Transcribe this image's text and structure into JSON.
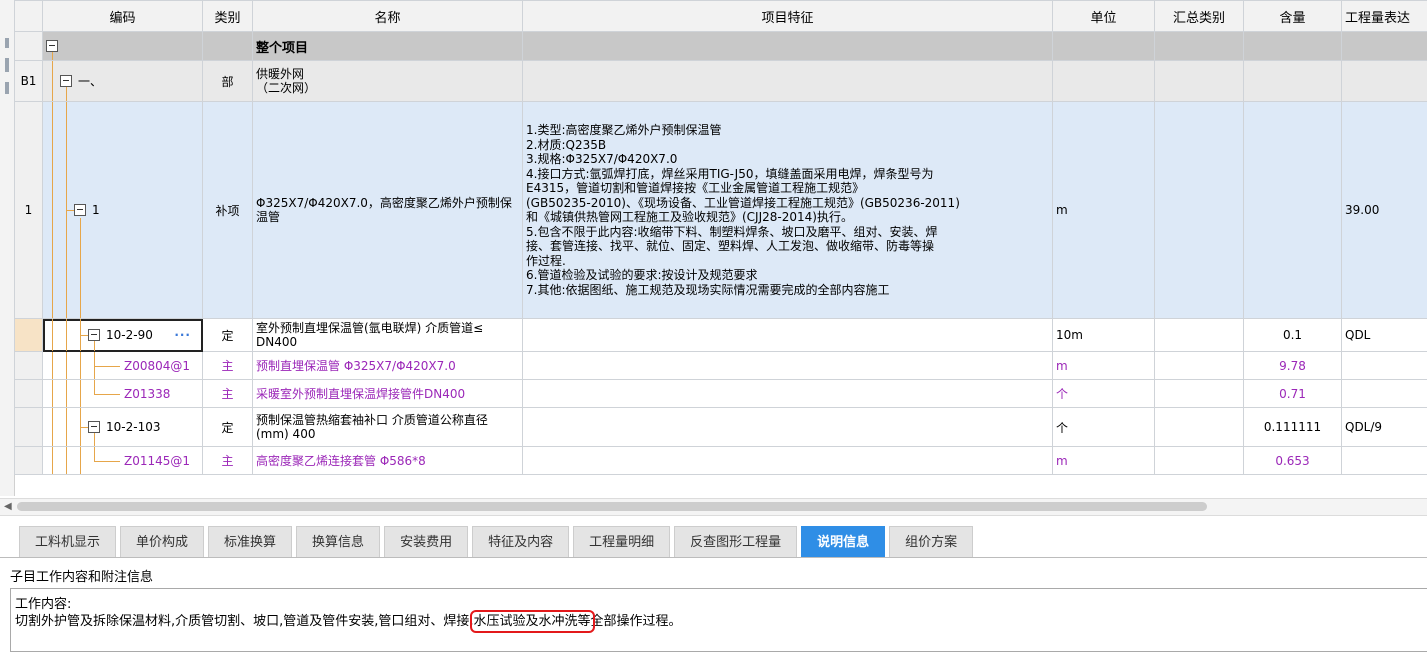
{
  "headers": {
    "code": "编码",
    "type": "类别",
    "name": "名称",
    "features": "项目特征",
    "unit": "单位",
    "summary": "汇总类别",
    "qty": "含量",
    "expr": "工程量表达"
  },
  "rows": {
    "whole": {
      "name": "整个项目"
    },
    "section": {
      "rownum": "B1",
      "code": "一、",
      "type": "部",
      "name": "供暖外网\n（二次网）"
    },
    "bill": {
      "rownum": "1",
      "code": "1",
      "type": "补项",
      "name": "Φ325X7/Φ420X7.0，高密度聚乙烯外户预制保温管",
      "unit": "m",
      "expr": "39.00",
      "features": [
        "1.类型:高密度聚乙烯外户预制保温管",
        "2.材质:Q235B",
        "3.规格:Φ325X7/Φ420X7.0",
        "4.接口方式:氩弧焊打底，焊丝采用TIG-J50，填缝盖面采用电焊，焊条型号为",
        "E4315，管道切割和管道焊接按《工业金属管道工程施工规范》",
        "(GB50235-2010)、《现场设备、工业管道焊接工程施工规范》(GB50236-2011)",
        "和《城镇供热管网工程施工及验收规范》(CJJ28-2014)执行。",
        "5.包含不限于此内容:收缩带下料、制塑料焊条、坡口及磨平、组对、安装、焊",
        "接、套管连接、找平、就位、固定、塑料焊、人工发泡、做收缩带、防毒等操",
        "作过程.",
        "6.管道检验及试验的要求:按设计及规范要求",
        "7.其他:依据图纸、施工规范及现场实际情况需要完成的全部内容施工"
      ]
    },
    "quota1": {
      "code": "10-2-90",
      "more": "···",
      "type": "定",
      "name": "室外预制直埋保温管(氩电联焊) 介质管道≤ DN400",
      "unit": "10m",
      "qty": "0.1",
      "expr": "QDL"
    },
    "res1": {
      "code": "Z00804@1",
      "type": "主",
      "name": "预制直埋保温管 Φ325X7/Φ420X7.0",
      "unit": "m",
      "qty": "9.78"
    },
    "res2": {
      "code": "Z01338",
      "type": "主",
      "name": "采暖室外预制直埋保温焊接管件DN400",
      "unit": "个",
      "qty": "0.71"
    },
    "quota2": {
      "code": "10-2-103",
      "type": "定",
      "name": "预制保温管热缩套袖补口 介质管道公称直径(mm) 400",
      "unit": "个",
      "qty": "0.111111",
      "expr": "QDL/9"
    },
    "res3": {
      "code": "Z01145@1",
      "type": "主",
      "name": "高密度聚乙烯连接套管 Φ586*8",
      "unit": "m",
      "qty": "0.653"
    }
  },
  "tabs": [
    "工料机显示",
    "单价构成",
    "标准换算",
    "换算信息",
    "安装费用",
    "特征及内容",
    "工程量明细",
    "反查图形工程量",
    "说明信息",
    "组价方案"
  ],
  "active_tab": "说明信息",
  "info": {
    "title": "子目工作内容和附注信息",
    "heading": "工作内容:",
    "text_before": "切割外护管及拆除保温材料,介质管切割、坡口,管道及管件安装,管口组对、焊接,",
    "text_highlight": "水压试验及水冲洗等",
    "text_after": "全部操作过程。"
  },
  "colors": {
    "accent": "#2f8ee6",
    "tree_line": "#e6a64a",
    "resource_text": "#9b27b8",
    "highlight_box": "#e3191b",
    "bill_row_bg": "#dde9f7"
  }
}
